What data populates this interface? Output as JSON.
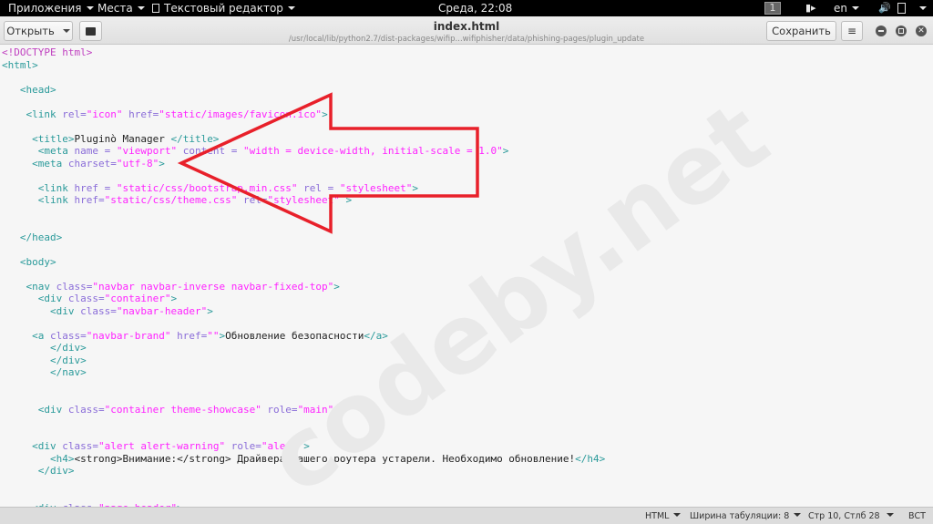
{
  "topbar": {
    "apps": "Приложения",
    "places": "Места",
    "app_menu": "Текстовый редактор",
    "clock": "Среда, 22:08",
    "workspace": "1",
    "lang": "en"
  },
  "toolbar": {
    "open_label": "Открыть",
    "save_label": "Сохранить",
    "title": "index.html",
    "path": "/usr/local/lib/python2.7/dist-packages/wifip...wifiphisher/data/phishing-pages/plugin_update"
  },
  "editor": {
    "lines": [
      [
        [
          "d",
          "<!DOCTYPE html>"
        ]
      ],
      [
        [
          "t",
          "<html>"
        ]
      ],
      [],
      [
        [
          "x",
          "   "
        ],
        [
          "t",
          "<head>"
        ]
      ],
      [],
      [
        [
          "x",
          "    "
        ],
        [
          "t",
          "<link "
        ],
        [
          "a",
          "rel="
        ],
        [
          "s",
          "\"icon\""
        ],
        [
          "a",
          " href="
        ],
        [
          "s",
          "\"static/images/favicon.ico\""
        ],
        [
          "t",
          ">"
        ]
      ],
      [],
      [
        [
          "x",
          "     "
        ],
        [
          "t",
          "<title>"
        ],
        [
          "x",
          "Pluginò Manager "
        ],
        [
          "t",
          "</title>"
        ]
      ],
      [
        [
          "x",
          "      "
        ],
        [
          "t",
          "<meta "
        ],
        [
          "a",
          "name = "
        ],
        [
          "s",
          "\"viewport\""
        ],
        [
          "a",
          " content = "
        ],
        [
          "s",
          "\"width = device-width, initial-scale = 1.0\""
        ],
        [
          "t",
          ">"
        ]
      ],
      [
        [
          "x",
          "     "
        ],
        [
          "t",
          "<meta "
        ],
        [
          "a",
          "charset="
        ],
        [
          "s",
          "\"utf-8\""
        ],
        [
          "t",
          ">"
        ]
      ],
      [],
      [
        [
          "x",
          "      "
        ],
        [
          "t",
          "<link "
        ],
        [
          "a",
          "href = "
        ],
        [
          "s",
          "\"static/css/bootstrap.min.css\""
        ],
        [
          "a",
          " rel = "
        ],
        [
          "s",
          "\"stylesheet\""
        ],
        [
          "t",
          ">"
        ]
      ],
      [
        [
          "x",
          "      "
        ],
        [
          "t",
          "<link "
        ],
        [
          "a",
          "href="
        ],
        [
          "s",
          "\"static/css/theme.css\""
        ],
        [
          "a",
          " rel="
        ],
        [
          "s",
          "\"stylesheet\""
        ],
        [
          "t",
          " >"
        ]
      ],
      [],
      [],
      [
        [
          "x",
          "   "
        ],
        [
          "t",
          "</head>"
        ]
      ],
      [],
      [
        [
          "x",
          "   "
        ],
        [
          "t",
          "<body>"
        ]
      ],
      [],
      [
        [
          "x",
          "    "
        ],
        [
          "t",
          "<nav "
        ],
        [
          "a",
          "class="
        ],
        [
          "s",
          "\"navbar navbar-inverse navbar-fixed-top\""
        ],
        [
          "t",
          ">"
        ]
      ],
      [
        [
          "x",
          "      "
        ],
        [
          "t",
          "<div "
        ],
        [
          "a",
          "class="
        ],
        [
          "s",
          "\"container\""
        ],
        [
          "t",
          ">"
        ]
      ],
      [
        [
          "x",
          "        "
        ],
        [
          "t",
          "<div "
        ],
        [
          "a",
          "class="
        ],
        [
          "s",
          "\"navbar-header\""
        ],
        [
          "t",
          ">"
        ]
      ],
      [],
      [
        [
          "x",
          "     "
        ],
        [
          "t",
          "<a "
        ],
        [
          "a",
          "class="
        ],
        [
          "s",
          "\"navbar-brand\""
        ],
        [
          "a",
          " href="
        ],
        [
          "s",
          "\"\""
        ],
        [
          "t",
          ">"
        ],
        [
          "x",
          "Обновление безопасности"
        ],
        [
          "t",
          "</a>"
        ]
      ],
      [
        [
          "x",
          "        "
        ],
        [
          "t",
          "</div>"
        ]
      ],
      [
        [
          "x",
          "        "
        ],
        [
          "t",
          "</div>"
        ]
      ],
      [
        [
          "x",
          "        "
        ],
        [
          "t",
          "</nav>"
        ]
      ],
      [],
      [],
      [
        [
          "x",
          "      "
        ],
        [
          "t",
          "<div "
        ],
        [
          "a",
          "class="
        ],
        [
          "s",
          "\"container theme-showcase\""
        ],
        [
          "a",
          " role="
        ],
        [
          "s",
          "\"main\""
        ],
        [
          "t",
          ">"
        ]
      ],
      [],
      [],
      [
        [
          "x",
          "     "
        ],
        [
          "t",
          "<div "
        ],
        [
          "a",
          "class="
        ],
        [
          "s",
          "\"alert alert-warning\""
        ],
        [
          "a",
          " role="
        ],
        [
          "s",
          "\"alert\""
        ],
        [
          "t",
          ">"
        ]
      ],
      [
        [
          "x",
          "        "
        ],
        [
          "t",
          "<h4>"
        ],
        [
          "x",
          "<strong>Внимание:</strong> Драйвера Вашего роутера устарели. Необходимо обновление!"
        ],
        [
          "t",
          "</h4>"
        ]
      ],
      [
        [
          "x",
          "      "
        ],
        [
          "t",
          "</div>"
        ]
      ],
      [],
      [],
      [
        [
          "x",
          "     "
        ],
        [
          "t",
          "<div "
        ],
        [
          "a",
          "class="
        ],
        [
          "s",
          "\"page-header\""
        ],
        [
          "t",
          ">"
        ]
      ]
    ]
  },
  "watermark": "codeby.net",
  "statusbar": {
    "language": "HTML",
    "tab_width": "Ширина табуляции: 8",
    "position": "Стр 10, Стлб 28",
    "mode": "ВСТ"
  },
  "colors": {
    "arrow": "#e8202a",
    "tag": "#2a9a9a",
    "attr": "#8a6cd8",
    "string": "#ff22ff"
  }
}
